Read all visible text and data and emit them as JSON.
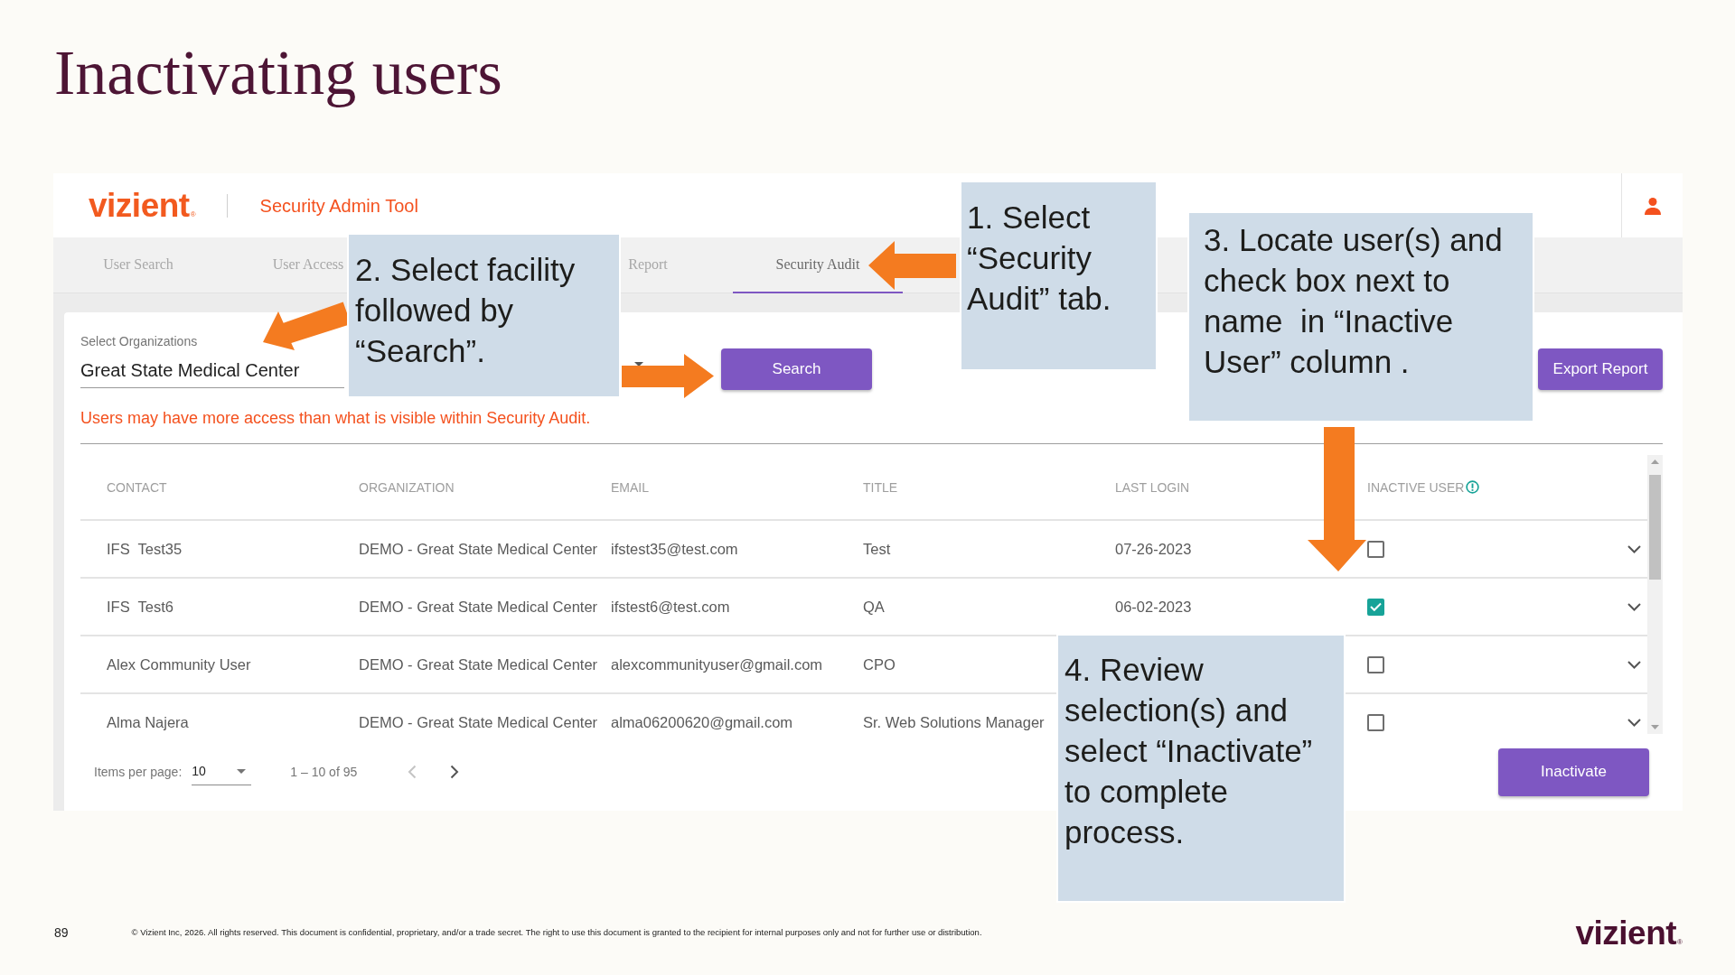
{
  "title": "Inactivating users",
  "app": {
    "logo": {
      "text": "vizient",
      "mark": "®"
    },
    "name": "Security Admin Tool"
  },
  "tabs": [
    {
      "label": "User Search",
      "selected": false
    },
    {
      "label": "User Access",
      "selected": false
    },
    {
      "label": "Report",
      "selected": false
    },
    {
      "label": "Security Audit",
      "selected": true
    }
  ],
  "organization_field": {
    "label": "Select Organizations",
    "value": "Great State Medical Center"
  },
  "search_button": "Search",
  "export_button": "Export Report",
  "notice": "Users may have more access than what is visible within Security Audit.",
  "table": {
    "columns": [
      "CONTACT",
      "ORGANIZATION",
      "EMAIL",
      "TITLE",
      "LAST LOGIN",
      "INACTIVE USER"
    ],
    "rows": [
      {
        "contact": "IFS  Test35",
        "organization": "DEMO - Great State Medical Center",
        "email": "ifstest35@test.com",
        "title": "Test",
        "last_login": "07-26-2023",
        "inactive": false
      },
      {
        "contact": "IFS  Test6",
        "organization": "DEMO - Great State Medical Center",
        "email": "ifstest6@test.com",
        "title": "QA",
        "last_login": "06-02-2023",
        "inactive": true
      },
      {
        "contact": "Alex Community User",
        "organization": "DEMO - Great State Medical Center",
        "email": "alexcommunityuser@gmail.com",
        "title": "CPO",
        "inactive": false
      },
      {
        "contact": "Alma Najera",
        "organization": "DEMO - Great State Medical Center",
        "email": "alma06200620@gmail.com",
        "title": "Sr. Web Solutions Manager",
        "inactive": false
      }
    ]
  },
  "paginator": {
    "label": "Items per page:",
    "page_size": "10",
    "range": "1 – 10 of 95",
    "prev_disabled": true,
    "next_disabled": false
  },
  "inactivate_button": "Inactivate",
  "callouts": [
    {
      "text": "1. Select “Security Audit” tab."
    },
    {
      "text": "2. Select facility followed by “Search”."
    },
    {
      "text": "3. Locate user(s) and check box next to name  in “Inactive User” column ."
    },
    {
      "text": "4. Review selection(s) and select “Inactivate” to complete process."
    }
  ],
  "footer": {
    "page": "89",
    "notice": "© Vizient Inc, 2026. All rights reserved. This document is confidential, proprietary, and/or a trade secret. The right to use this document is granted to the recipient for internal purposes only and not for further use or distribution.",
    "logo": {
      "text": "vizient",
      "mark": "®"
    }
  }
}
